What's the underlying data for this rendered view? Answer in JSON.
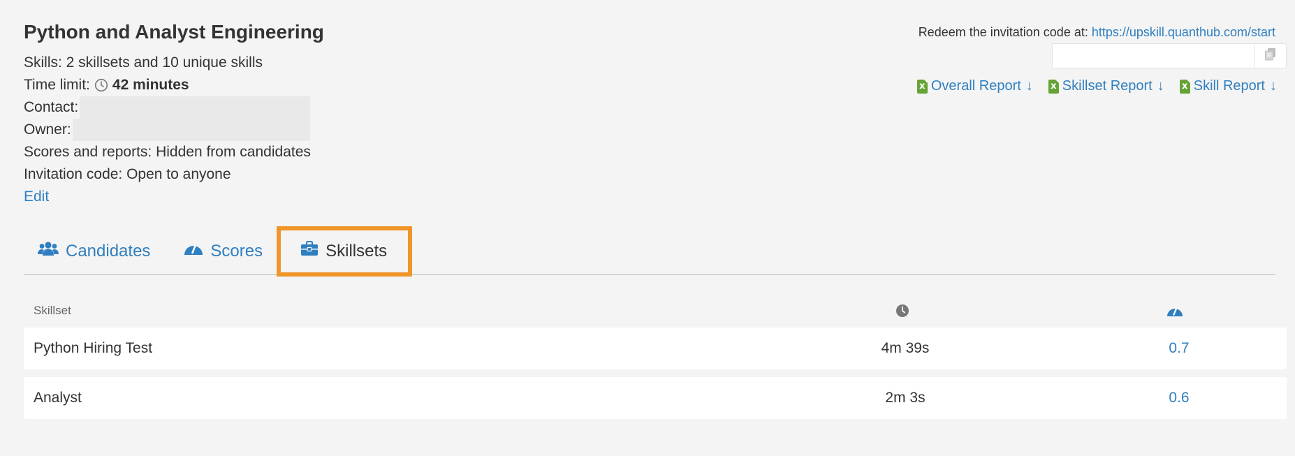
{
  "assessment": {
    "title": "Python and Analyst Engineering",
    "skills_line": "Skills: 2 skillsets and 10 unique skills",
    "time_limit_label": "Time limit:",
    "time_limit_value": "42 minutes",
    "contact_label": "Contact:",
    "owner_label": "Owner:",
    "scores_line": "Scores and reports: Hidden from candidates",
    "invitation_line": "Invitation code: Open to anyone",
    "edit_label": "Edit"
  },
  "redeem": {
    "text": "Redeem the invitation code at:",
    "url": "https://upskill.quanthub.com/start",
    "code_value": ""
  },
  "reports": [
    {
      "label": "Overall Report"
    },
    {
      "label": "Skillset Report"
    },
    {
      "label": "Skill Report"
    }
  ],
  "tabs": [
    {
      "label": "Candidates",
      "icon": "users-icon"
    },
    {
      "label": "Scores",
      "icon": "gauge-icon"
    },
    {
      "label": "Skillsets",
      "icon": "toolbox-icon",
      "active": true
    }
  ],
  "table": {
    "columns": {
      "skillset": "Skillset",
      "time_icon": "clock-icon",
      "score_icon": "gauge-icon"
    },
    "rows": [
      {
        "skillset": "Python Hiring Test",
        "time": "4m 39s",
        "score": "0.7"
      },
      {
        "skillset": "Analyst",
        "time": "2m 3s",
        "score": "0.6"
      }
    ]
  },
  "colors": {
    "link": "#2f7fc0",
    "active_tab_highlight": "#f0952a",
    "excel_icon": "#66a336",
    "background": "#f4f4f4"
  }
}
